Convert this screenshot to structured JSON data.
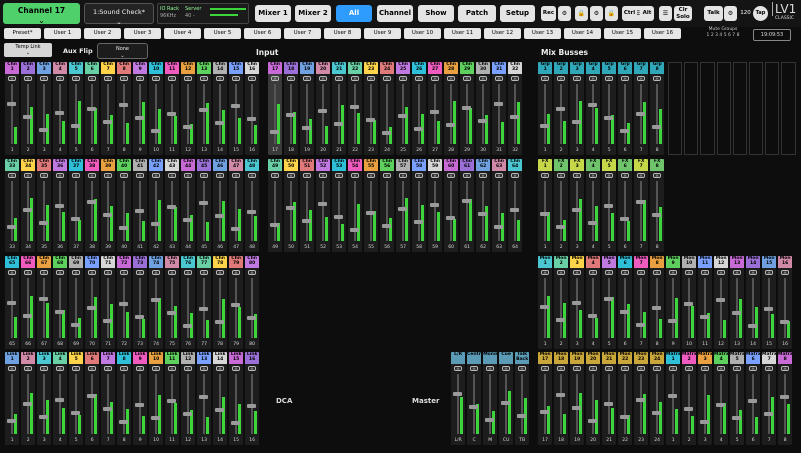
{
  "topbar": {
    "channel_label": "Channel 17",
    "session_label": "1:Sound Check*",
    "io_rack": "IO Rack",
    "io_rate": "96KHz",
    "server": "Server",
    "server_levels": "40 -",
    "nav": [
      "Mixer 1",
      "Mixer 2",
      "All",
      "Channel",
      "Show",
      "Patch",
      "Setup"
    ],
    "active_nav": "All",
    "rec": "Rec",
    "ctrl": "Ctrl",
    "alt": "Alt",
    "clr_solo": "Clr Solo",
    "talk": "Talk",
    "bpm": "120",
    "tap": "Tap",
    "logo": "LV1",
    "logo_sub": "CLASSIC"
  },
  "users": [
    "Preset*",
    "User 1",
    "User 2",
    "User 3",
    "User 4",
    "User 5",
    "User 6",
    "User 7",
    "User 8",
    "User 9",
    "User 10",
    "User 11",
    "User 12",
    "User 13",
    "User 14",
    "User 15",
    "User 16"
  ],
  "mute_groups": "Mute Groups",
  "mute_group_numbers": "1 2 3 4 5 6 7 8",
  "clock": "19:09:53",
  "temp_link": "Temp Link",
  "aux_flip": "Aux Flip",
  "aux_flip_value": "None",
  "sections": {
    "input": "Input",
    "mix_busses": "Mix Busses",
    "dca": "DCA",
    "master": "Master"
  },
  "mute_label": "M",
  "input_names_row1": [
    "Chn",
    "Chn",
    "Chn",
    "Chn",
    "Chn",
    "Chn",
    "Chn",
    "Chn",
    "Chn",
    "Chn",
    "Chn",
    "Chn",
    "Chn",
    "Chn",
    "Chn",
    "Chn",
    "Chn",
    "Chn",
    "Chn",
    "Chn",
    "Chn",
    "Chn",
    "Chn",
    "Chn",
    "Chn",
    "Chn",
    "Chn",
    "Chn",
    "Chn",
    "Chn",
    "Chn",
    "Chn"
  ],
  "input_names_row2": [
    "Chn",
    "Chn",
    "Chn",
    "Chn",
    "Chn",
    "Chn",
    "Chn",
    "Chn",
    "Chn",
    "Chn",
    "Chn",
    "Chn",
    "Chn",
    "Chn",
    "Chn",
    "Chn",
    "Chn",
    "Chn",
    "Chn",
    "Chn",
    "Chn",
    "Chn",
    "Chn",
    "Chn",
    "Chn",
    "Chn",
    "Chn",
    "Chn",
    "Chn",
    "Chn",
    "Chn",
    "Chn"
  ],
  "input_names_row3": [
    "Chn",
    "Chn",
    "Chn",
    "Chn",
    "Chn",
    "Chn",
    "Chn",
    "Chn",
    "Chn",
    "Chn",
    "Chn",
    "Chn",
    "Chn",
    "Chn",
    "Chn",
    "Chn"
  ],
  "input_names_row4": [
    "Link",
    "Link",
    "Link",
    "Link",
    "Link",
    "Link",
    "Link",
    "Link",
    "Link",
    "Link",
    "Link",
    "Link",
    "Link",
    "Link",
    "Link",
    "Link"
  ],
  "bus_names_row1": [
    "Grp",
    "Grp",
    "Grp",
    "Grp",
    "Grp",
    "Grp",
    "Grp",
    "Grp"
  ],
  "bus_names_row2": [
    "FX",
    "FX",
    "FX",
    "FX",
    "FX",
    "FX",
    "FX",
    "FX"
  ],
  "bus_names_row3": [
    "Mon",
    "Mon",
    "Mon",
    "Mon",
    "Mon",
    "Mon",
    "Mon",
    "Mon",
    "Mon",
    "Mon",
    "Mon",
    "Mon",
    "Mon",
    "Mon",
    "Mon",
    "Mon"
  ],
  "bus_names_row4": [
    "Mon",
    "Mon",
    "Mon",
    "Mon",
    "Mon",
    "Mon",
    "Mon",
    "Mon",
    "Matrx",
    "Matrx",
    "Matrx",
    "Matrx",
    "Matrx",
    "Matrx",
    "Matrx",
    "Matrx"
  ],
  "master_names": [
    "L/R",
    "Centre",
    "Mono",
    "Cue",
    "Talk Back"
  ],
  "master_footers": [
    "L/R",
    "C",
    "M",
    "CU",
    "TB"
  ],
  "colors": {
    "accent": "#2e9bff",
    "green": "#4fd06a",
    "meter": "#3cd63c"
  }
}
